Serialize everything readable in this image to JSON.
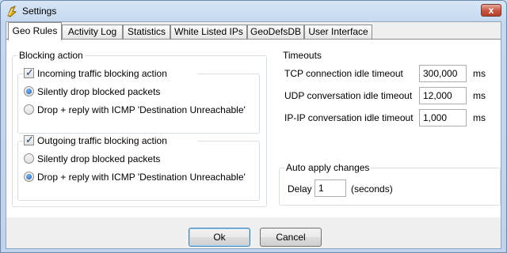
{
  "window": {
    "title": "Settings",
    "close_symbol": "x"
  },
  "tabs": [
    {
      "label": "Geo Rules",
      "active": true
    },
    {
      "label": "Activity Log",
      "active": false
    },
    {
      "label": "Statistics",
      "active": false
    },
    {
      "label": "White Listed IPs",
      "active": false
    },
    {
      "label": "GeoDefsDB",
      "active": false
    },
    {
      "label": "User Interface",
      "active": false
    }
  ],
  "blocking": {
    "legend": "Blocking action",
    "incoming": {
      "label": "Incoming traffic blocking action",
      "checked": true,
      "options": [
        {
          "label": "Silently drop blocked packets",
          "selected": true
        },
        {
          "label": "Drop + reply with ICMP 'Destination Unreachable'",
          "selected": false
        }
      ]
    },
    "outgoing": {
      "label": "Outgoing traffic blocking action",
      "checked": true,
      "options": [
        {
          "label": "Silently drop blocked packets",
          "selected": false
        },
        {
          "label": "Drop + reply with ICMP 'Destination Unreachable'",
          "selected": true
        }
      ]
    }
  },
  "timeouts": {
    "legend": "Timeouts",
    "rows": [
      {
        "label": "TCP connection idle timeout",
        "value": "300,000",
        "unit": "ms"
      },
      {
        "label": "UDP conversation idle timeout",
        "value": "12,000",
        "unit": "ms"
      },
      {
        "label": "IP-IP conversation idle timeout",
        "value": "1,000",
        "unit": "ms"
      }
    ]
  },
  "auto_apply": {
    "legend": "Auto apply changes",
    "delay_label": "Delay",
    "delay_value": "1",
    "unit": "(seconds)"
  },
  "buttons": {
    "ok": "Ok",
    "cancel": "Cancel"
  }
}
